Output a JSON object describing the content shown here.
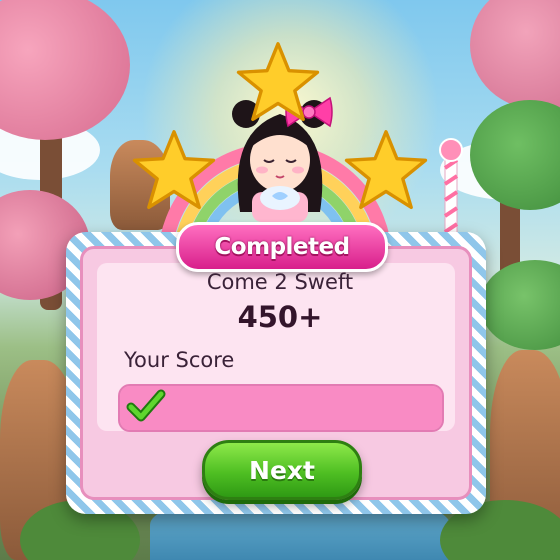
{
  "dialog": {
    "banner_label": "Completed",
    "level_name": "Come 2 Sweft",
    "score_value": "450+",
    "score_label": "Your Score",
    "next_label": "Next"
  },
  "progress": {
    "value": 1.0
  },
  "stars": {
    "earned": 3,
    "total": 3
  },
  "colors": {
    "banner": "#e0339b",
    "panel": "#fde4f1",
    "progress_bar": "#f98bc4",
    "next_button": "#4fbf23",
    "star": "#ffc21a",
    "check": "#3fbf1f"
  },
  "icons": {
    "star": "star-icon",
    "check": "check-icon",
    "bow": "bow-icon"
  }
}
